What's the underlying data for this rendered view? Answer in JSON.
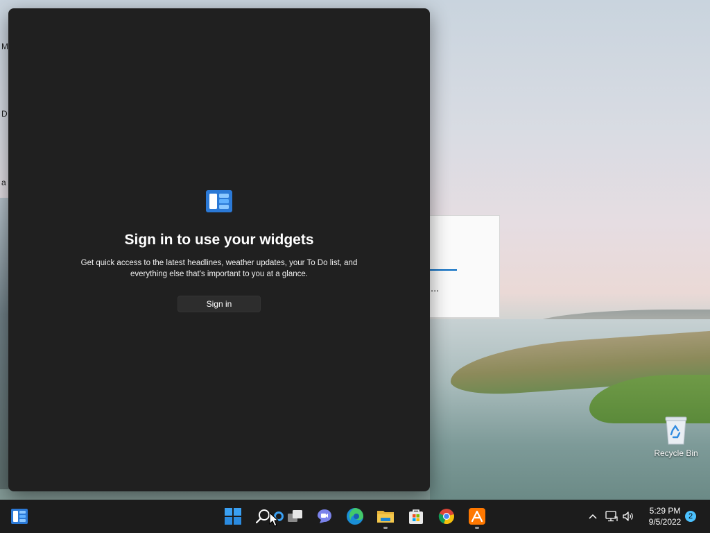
{
  "desktop": {
    "edge_labels": [
      "M",
      "D",
      "a"
    ],
    "background_window": {
      "ellipsis": "..."
    },
    "icons": [
      {
        "label": "Recycle Bin",
        "icon": "recycle-bin-icon"
      }
    ]
  },
  "widgets_panel": {
    "icon": "widgets-icon",
    "title": "Sign in to use your widgets",
    "description": "Get quick access to the latest headlines, weather updates, your To Do list, and everything else that's important to you at a glance.",
    "signin_button": "Sign in"
  },
  "taskbar": {
    "widgets_button": "widgets-icon",
    "apps": [
      {
        "name": "start",
        "icon": "windows-start-icon"
      },
      {
        "name": "search",
        "icon": "search-icon"
      },
      {
        "name": "cortana",
        "icon": "cortana-icon"
      },
      {
        "name": "task-view",
        "icon": "task-view-icon"
      },
      {
        "name": "teams-chat",
        "icon": "teams-chat-icon"
      },
      {
        "name": "edge",
        "icon": "edge-icon"
      },
      {
        "name": "file-explorer",
        "icon": "folder-icon",
        "running": true
      },
      {
        "name": "microsoft-store",
        "icon": "store-icon"
      },
      {
        "name": "chrome",
        "icon": "chrome-icon"
      },
      {
        "name": "avast",
        "icon": "avast-icon",
        "running": true
      }
    ],
    "tray": {
      "icons": [
        "chevron-up-icon",
        "network-icon",
        "volume-icon"
      ],
      "time": "5:29 PM",
      "date": "9/5/2022",
      "notification_count": "2"
    }
  },
  "colors": {
    "panel_bg": "#202020",
    "taskbar_bg": "#1c1c1c",
    "accent": "#0067c0",
    "badge": "#4cc2ff"
  }
}
